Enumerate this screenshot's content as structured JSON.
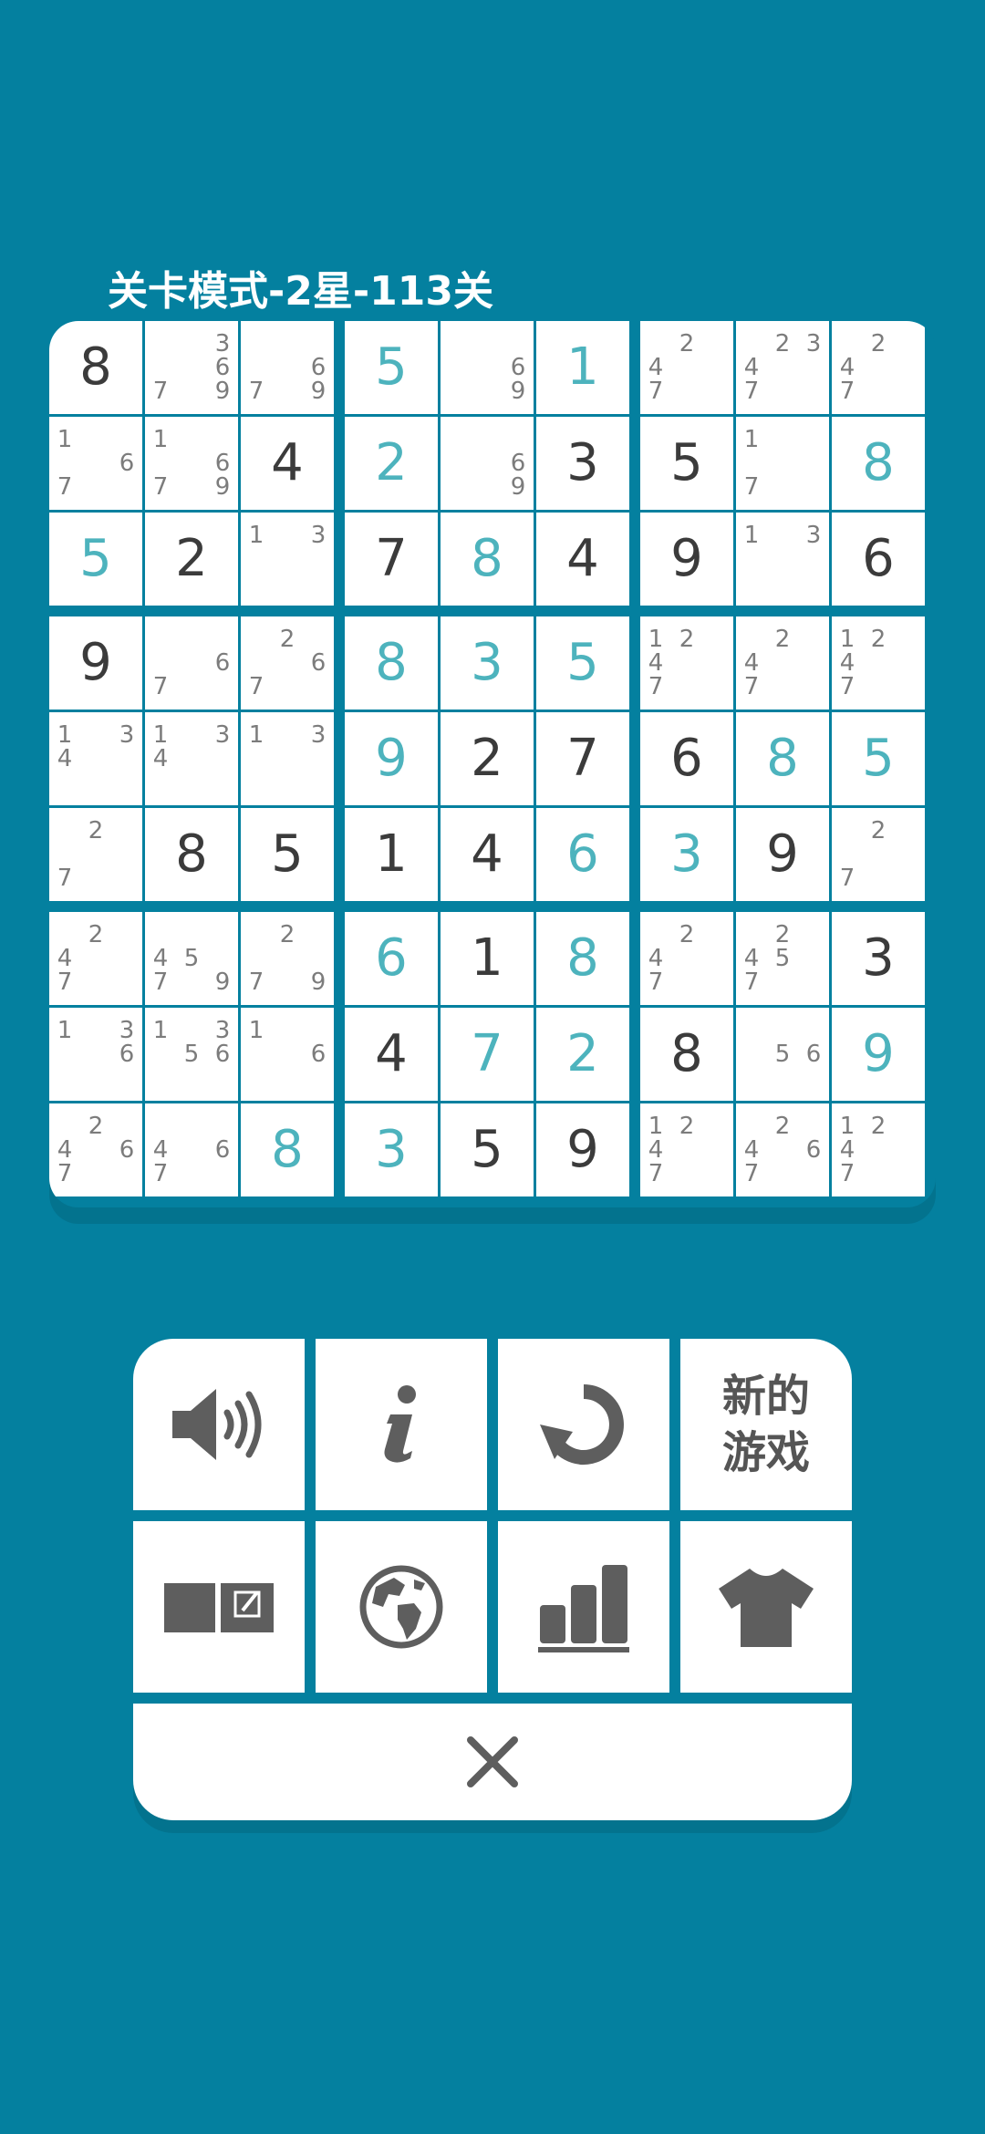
{
  "header": {
    "title": "关卡模式-2星-113关"
  },
  "colors": {
    "background": "#04809f",
    "given_digit": "#3b3b3b",
    "user_digit": "#4db3bd",
    "note": "#7c7c7c",
    "icon": "#5e5e5e"
  },
  "grid": [
    [
      {
        "v": "8",
        "t": "given"
      },
      {
        "n": [
          "3",
          "6",
          "7",
          "9"
        ]
      },
      {
        "n": [
          "6",
          "7",
          "9"
        ]
      },
      {
        "v": "5",
        "t": "user"
      },
      {
        "n": [
          "6",
          "9"
        ]
      },
      {
        "v": "1",
        "t": "user"
      },
      {
        "n": [
          "2",
          "4",
          "7"
        ]
      },
      {
        "n": [
          "2",
          "3",
          "4",
          "7"
        ]
      },
      {
        "n": [
          "2",
          "4",
          "7"
        ]
      }
    ],
    [
      {
        "n": [
          "1",
          "6",
          "7"
        ]
      },
      {
        "n": [
          "1",
          "6",
          "7",
          "9"
        ]
      },
      {
        "v": "4",
        "t": "given"
      },
      {
        "v": "2",
        "t": "user"
      },
      {
        "n": [
          "6",
          "9"
        ]
      },
      {
        "v": "3",
        "t": "given"
      },
      {
        "v": "5",
        "t": "given"
      },
      {
        "n": [
          "1",
          "7"
        ]
      },
      {
        "v": "8",
        "t": "user"
      }
    ],
    [
      {
        "v": "5",
        "t": "user"
      },
      {
        "v": "2",
        "t": "given"
      },
      {
        "n": [
          "1",
          "3"
        ]
      },
      {
        "v": "7",
        "t": "given"
      },
      {
        "v": "8",
        "t": "user"
      },
      {
        "v": "4",
        "t": "given"
      },
      {
        "v": "9",
        "t": "given"
      },
      {
        "n": [
          "1",
          "3"
        ]
      },
      {
        "v": "6",
        "t": "given"
      }
    ],
    [
      {
        "v": "9",
        "t": "given"
      },
      {
        "n": [
          "6",
          "7"
        ]
      },
      {
        "n": [
          "2",
          "6",
          "7"
        ]
      },
      {
        "v": "8",
        "t": "user"
      },
      {
        "v": "3",
        "t": "user"
      },
      {
        "v": "5",
        "t": "user"
      },
      {
        "n": [
          "1",
          "2",
          "4",
          "7"
        ]
      },
      {
        "n": [
          "2",
          "4",
          "7"
        ]
      },
      {
        "n": [
          "1",
          "2",
          "4",
          "7"
        ]
      }
    ],
    [
      {
        "n": [
          "1",
          "3",
          "4"
        ]
      },
      {
        "n": [
          "1",
          "3",
          "4"
        ]
      },
      {
        "n": [
          "1",
          "3"
        ]
      },
      {
        "v": "9",
        "t": "user"
      },
      {
        "v": "2",
        "t": "given"
      },
      {
        "v": "7",
        "t": "given"
      },
      {
        "v": "6",
        "t": "given"
      },
      {
        "v": "8",
        "t": "user"
      },
      {
        "v": "5",
        "t": "user"
      }
    ],
    [
      {
        "n": [
          "2",
          "7"
        ]
      },
      {
        "v": "8",
        "t": "given"
      },
      {
        "v": "5",
        "t": "given"
      },
      {
        "v": "1",
        "t": "given"
      },
      {
        "v": "4",
        "t": "given"
      },
      {
        "v": "6",
        "t": "user"
      },
      {
        "v": "3",
        "t": "user"
      },
      {
        "v": "9",
        "t": "given"
      },
      {
        "n": [
          "2",
          "7"
        ]
      }
    ],
    [
      {
        "n": [
          "2",
          "4",
          "7"
        ]
      },
      {
        "n": [
          "4",
          "5",
          "7",
          "9"
        ]
      },
      {
        "n": [
          "2",
          "7",
          "9"
        ]
      },
      {
        "v": "6",
        "t": "user"
      },
      {
        "v": "1",
        "t": "given"
      },
      {
        "v": "8",
        "t": "user"
      },
      {
        "n": [
          "2",
          "4",
          "7"
        ]
      },
      {
        "n": [
          "2",
          "4",
          "5",
          "7"
        ]
      },
      {
        "v": "3",
        "t": "given"
      }
    ],
    [
      {
        "n": [
          "1",
          "3",
          "6"
        ]
      },
      {
        "n": [
          "1",
          "3",
          "5",
          "6"
        ]
      },
      {
        "n": [
          "1",
          "6"
        ]
      },
      {
        "v": "4",
        "t": "given"
      },
      {
        "v": "7",
        "t": "user"
      },
      {
        "v": "2",
        "t": "user"
      },
      {
        "v": "8",
        "t": "given"
      },
      {
        "n": [
          "5",
          "6"
        ]
      },
      {
        "v": "9",
        "t": "user"
      }
    ],
    [
      {
        "n": [
          "2",
          "4",
          "6",
          "7"
        ]
      },
      {
        "n": [
          "4",
          "6",
          "7"
        ]
      },
      {
        "v": "8",
        "t": "user"
      },
      {
        "v": "3",
        "t": "user"
      },
      {
        "v": "5",
        "t": "given"
      },
      {
        "v": "9",
        "t": "given"
      },
      {
        "n": [
          "1",
          "2",
          "4",
          "7"
        ]
      },
      {
        "n": [
          "2",
          "4",
          "6",
          "7"
        ]
      },
      {
        "n": [
          "1",
          "2",
          "4",
          "7"
        ]
      }
    ]
  ],
  "menu": {
    "items": [
      {
        "name": "sound-button",
        "icon": "speaker-icon",
        "label": ""
      },
      {
        "name": "info-button",
        "icon": "info-icon",
        "label": ""
      },
      {
        "name": "restart-button",
        "icon": "restart-icon",
        "label": ""
      },
      {
        "name": "new-game-button",
        "icon": "",
        "label": "新的\n游戏"
      },
      {
        "name": "notes-button",
        "icon": "notepad-icon",
        "label": ""
      },
      {
        "name": "globe-button",
        "icon": "globe-icon",
        "label": ""
      },
      {
        "name": "stats-button",
        "icon": "bar-chart-icon",
        "label": ""
      },
      {
        "name": "theme-button",
        "icon": "tshirt-icon",
        "label": ""
      }
    ],
    "close_icon": "close-icon"
  }
}
